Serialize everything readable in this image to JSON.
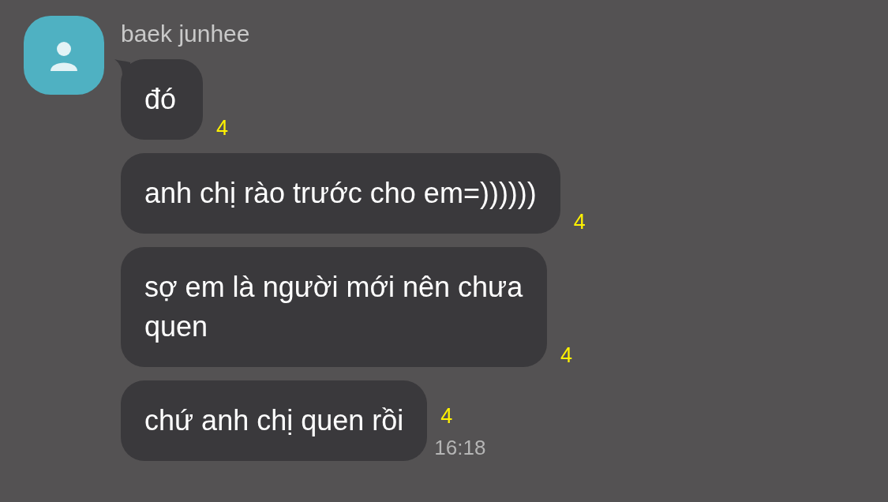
{
  "sender": {
    "name": "baek junhee"
  },
  "messages": [
    {
      "text": "đó",
      "unread": "4"
    },
    {
      "text": "anh chị rào trước cho em=))))))",
      "unread": "4"
    },
    {
      "text": "sợ em là người mới nên chưa quen",
      "unread": "4"
    },
    {
      "text": "chứ anh chị quen rồi",
      "unread": "4",
      "time": "16:18"
    }
  ]
}
